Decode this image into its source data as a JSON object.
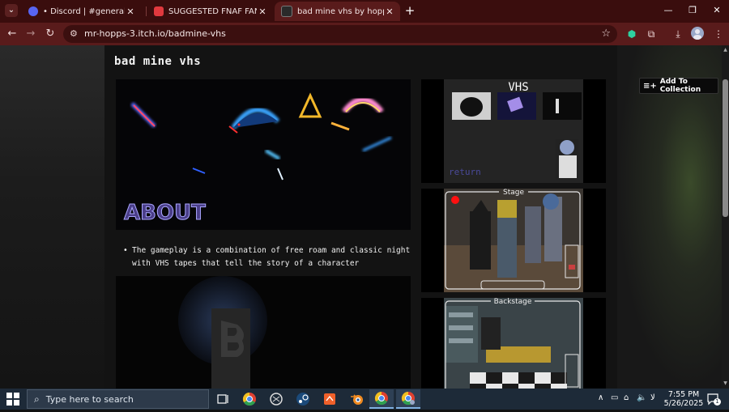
{
  "browser": {
    "tabs": [
      {
        "title": "• Discord | #general | Mrhopps",
        "active": false
      },
      {
        "title": "SUGGESTED FNAF FANGAMES",
        "active": false
      },
      {
        "title": "bad mine vhs by hopps entertainment",
        "active": true
      }
    ],
    "url": "mr-hopps-3.itch.io/badmine-vhs"
  },
  "page": {
    "game_title": "bad mine vhs",
    "add_to_collection": "Add To Collection",
    "about_label": "ABOUT",
    "description_bullet": "The gameplay is a combination of free roam and classic night with VHS tapes that tell the story of a character",
    "screenshots": [
      {
        "heading": "VHS",
        "caption": "return"
      },
      {
        "heading": "Stage"
      },
      {
        "heading": "Backstage"
      }
    ]
  },
  "taskbar": {
    "search_placeholder": "Type here to search",
    "time": "7:55 PM",
    "date": "5/26/2025",
    "notification_count": "1",
    "tray_lang": "لا"
  },
  "colors": {
    "tab_strip": "#3a0d0d",
    "toolbar": "#591b1b",
    "taskbar": "#1d2a38"
  }
}
